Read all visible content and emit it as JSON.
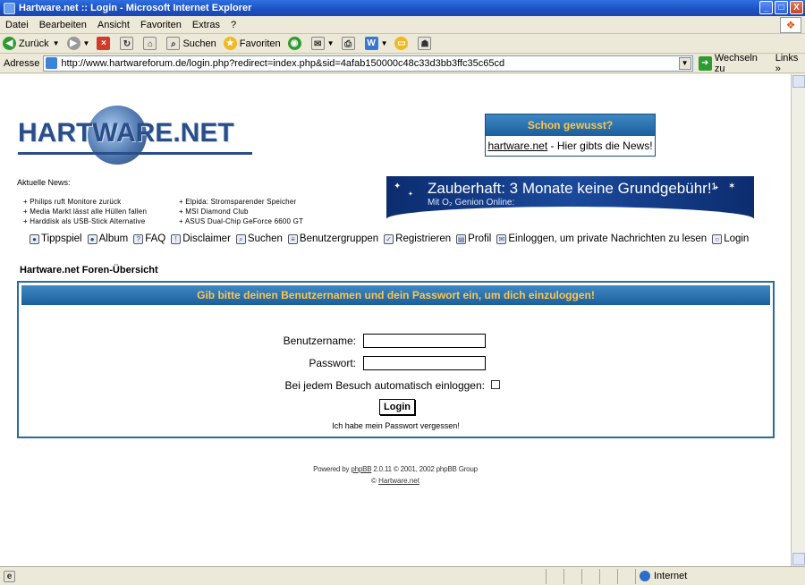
{
  "window": {
    "title": "Hartware.net :: Login - Microsoft Internet Explorer",
    "buttons": [
      "_",
      "□",
      "X"
    ]
  },
  "menu": [
    "Datei",
    "Bearbeiten",
    "Ansicht",
    "Favoriten",
    "Extras",
    "?"
  ],
  "toolbar": {
    "back_label": "Zurück",
    "search_label": "Suchen",
    "favorites_label": "Favoriten"
  },
  "addressbar": {
    "label": "Adresse",
    "url": "http://www.hartwareforum.de/login.php?redirect=index.php&sid=4afab150000c48c33d3bb3ffc35c65cd",
    "go_label": "Wechseln zu",
    "links_label": "Links »"
  },
  "site": {
    "logo_text": "HARTWARE.NET",
    "info_box": {
      "heading": "Schon gewusst?",
      "link_text": "hartware.net",
      "text": " - Hier gibts die News!"
    },
    "news_heading": "Aktuelle News:",
    "news_col1": [
      "+ Philips ruft Monitore zurück",
      "+ Media Markt lässt alle Hüllen fallen",
      "+ Harddisk als USB-Stick Alternative"
    ],
    "news_col2": [
      "+ Elpida: Stromsparender Speicher",
      "+ MSI Diamond Club",
      "+ ASUS Dual-Chip GeForce 6600 GT"
    ],
    "banner": {
      "title": "Zauberhaft: 3 Monate keine Grundgebühr!¹",
      "subtitle": "Mit O₂ Genion Online:"
    },
    "nav": [
      {
        "label": "Tippspiel",
        "icon": "tippspiel-icon"
      },
      {
        "label": "Album",
        "icon": "album-icon"
      },
      {
        "label": "FAQ",
        "icon": "faq-icon"
      },
      {
        "label": "Disclaimer",
        "icon": "disclaimer-icon"
      },
      {
        "label": "Suchen",
        "icon": "search-icon"
      },
      {
        "label": "Benutzergruppen",
        "icon": "groups-icon"
      },
      {
        "label": "Registrieren",
        "icon": "register-icon"
      },
      {
        "label": "Profil",
        "icon": "profile-icon"
      },
      {
        "label": "Einloggen, um private Nachrichten zu lesen",
        "icon": "messages-icon"
      },
      {
        "label": "Login",
        "icon": "login-icon"
      }
    ],
    "forum_title": "Hartware.net Foren-Übersicht",
    "login": {
      "heading": "Gib bitte deinen Benutzernamen und dein Passwort ein, um dich einzuloggen!",
      "username_label": "Benutzername:",
      "username_value": "",
      "password_label": "Passwort:",
      "password_value": "",
      "autologin_label": "Bei jedem Besuch automatisch einloggen:",
      "autologin_checked": false,
      "button_label": "Login",
      "forgot_label": "Ich habe mein Passwort vergessen!"
    },
    "footer": {
      "powered_prefix": "Powered by ",
      "phpbb_link": "phpBB",
      "powered_suffix": " 2.0.11 © 2001, 2002 phpBB Group",
      "copyright_prefix": "© ",
      "copyright_link": "Hartware.net"
    }
  },
  "statusbar": {
    "zone": "Internet"
  },
  "colors": {
    "header_gradient_top": "#3e88c2",
    "header_gradient_bottom": "#1b5f9d",
    "header_text": "#ffc64a",
    "panel_border": "#2a6a9f",
    "logo_blue": "#2a4e89"
  }
}
